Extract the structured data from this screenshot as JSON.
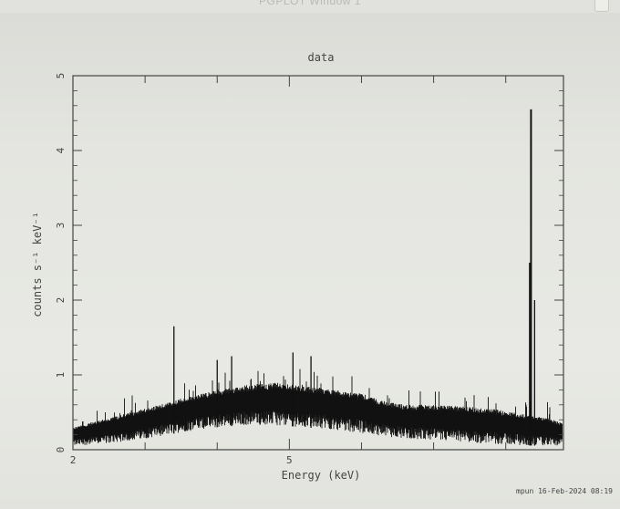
{
  "window": {
    "title": "PGPLOT Window 1"
  },
  "footer": {
    "stamp": "mpun 16-Feb-2024 08:19"
  },
  "colors": {
    "background": "#e7e8e3",
    "ink": "#111111",
    "axis": "#444444"
  },
  "chart_data": {
    "type": "line",
    "title": "data",
    "xlabel": "Energy (keV)",
    "ylabel": "counts s⁻¹ keV⁻¹",
    "xlim": [
      2,
      8.8
    ],
    "ylim": [
      0,
      5
    ],
    "x_tick_labels": [
      "2",
      "5"
    ],
    "y_tick_labels": [
      "0",
      "1",
      "2",
      "3",
      "4",
      "5"
    ],
    "envelope": {
      "x": [
        2.0,
        2.4,
        2.8,
        3.2,
        3.6,
        4.0,
        4.4,
        4.8,
        5.2,
        5.6,
        6.0,
        6.3,
        6.6,
        7.0,
        7.4,
        7.8,
        8.2,
        8.6,
        8.8
      ],
      "low": [
        0.05,
        0.08,
        0.12,
        0.18,
        0.25,
        0.3,
        0.33,
        0.33,
        0.3,
        0.27,
        0.22,
        0.18,
        0.15,
        0.12,
        0.1,
        0.08,
        0.06,
        0.05,
        0.05
      ],
      "high": [
        0.3,
        0.4,
        0.5,
        0.6,
        0.7,
        0.8,
        0.85,
        0.9,
        0.85,
        0.8,
        0.75,
        0.65,
        0.6,
        0.6,
        0.58,
        0.55,
        0.48,
        0.42,
        0.35
      ]
    },
    "lines": [
      {
        "x": 3.4,
        "y": 1.65
      },
      {
        "x": 4.0,
        "y": 1.2
      },
      {
        "x": 4.2,
        "y": 1.25
      },
      {
        "x": 5.05,
        "y": 1.3
      },
      {
        "x": 5.3,
        "y": 1.25
      },
      {
        "x": 8.35,
        "y": 4.55
      },
      {
        "x": 8.33,
        "y": 2.5
      },
      {
        "x": 8.4,
        "y": 2.0
      }
    ]
  }
}
